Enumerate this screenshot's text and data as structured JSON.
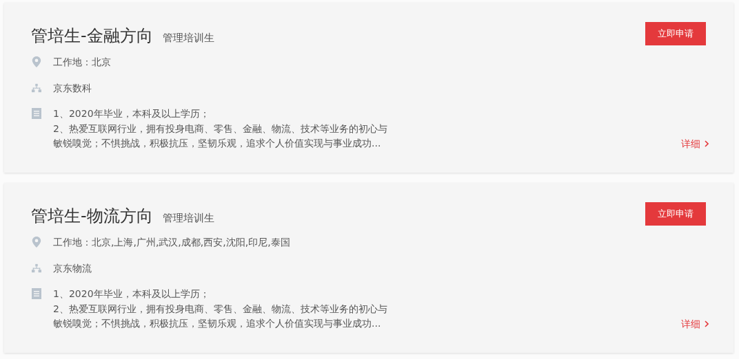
{
  "jobs": [
    {
      "title": "管培生-金融方向",
      "category": "管理培训生",
      "location": "工作地：北京",
      "department": "京东数科",
      "description_lines": [
        "1、2020年毕业，本科及以上学历；",
        "2、热爱互联网行业，拥有投身电商、零售、金融、物流、技术等业务的初心与",
        "敏锐嗅觉；不惧挑战，积极抗压，坚韧乐观，追求个人价值实现与事业成功..."
      ],
      "apply_button": "立即申请",
      "details_link": "详细"
    },
    {
      "title": "管培生-物流方向",
      "category": "管理培训生",
      "location": "工作地：北京,上海,广州,武汉,成都,西安,沈阳,印尼,泰国",
      "department": "京东物流",
      "description_lines": [
        "1、2020年毕业，本科及以上学历；",
        "2、热爱互联网行业，拥有投身电商、零售、金融、物流、技术等业务的初心与",
        "敏锐嗅觉；不惧挑战，积极抗压，坚韧乐观，追求个人价值实现与事业成功..."
      ],
      "apply_button": "立即申请",
      "details_link": "详细"
    }
  ]
}
